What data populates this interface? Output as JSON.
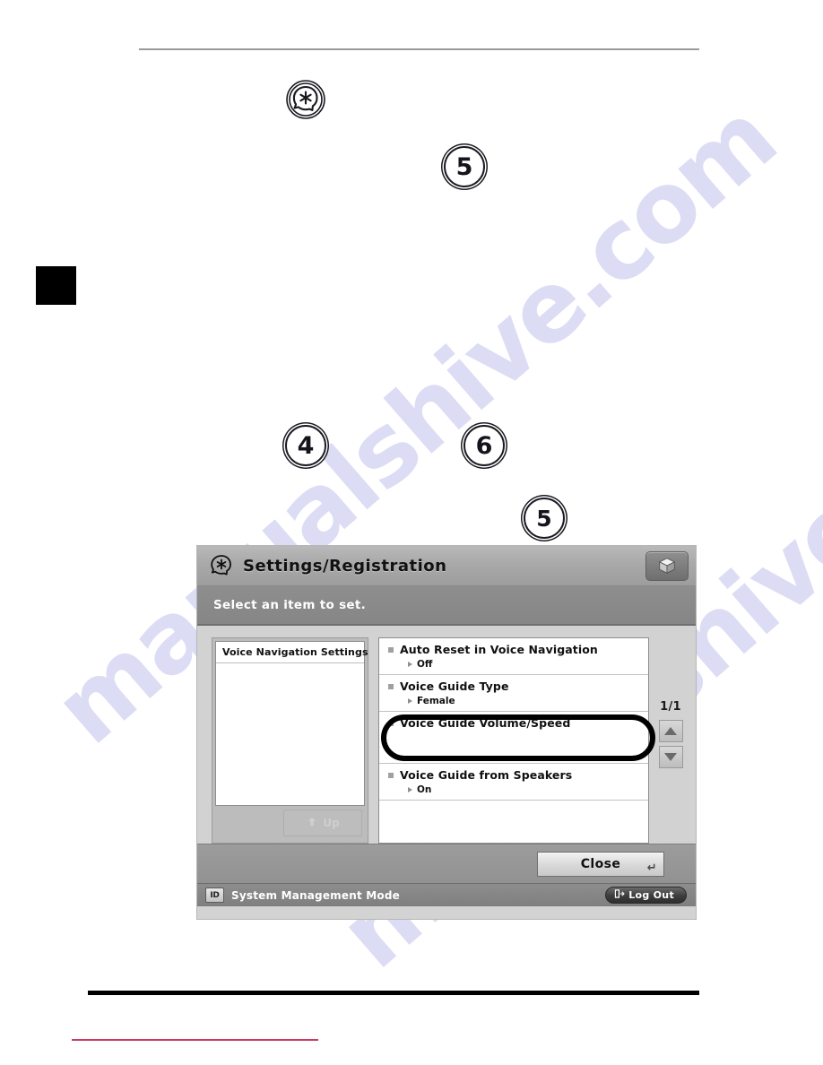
{
  "page": {
    "watermark_text": "manualshive.com",
    "chapter_tab": "",
    "step_markers": {
      "step_four": "4",
      "step_five_top": "5",
      "step_five_bottom": "5",
      "step_six": "6"
    },
    "key_icon_name": "settings-registration-key-icon"
  },
  "screen": {
    "titlebar": {
      "title": "Settings/Registration",
      "key_icon": "settings-registration-icon",
      "cube_button_icon": "cube-icon"
    },
    "message": "Select an item to set.",
    "left_panel": {
      "list_title": "Voice Navigation Settings",
      "up_button_label": "Up",
      "up_button_icon": "arrow-up-return-icon"
    },
    "settings_list": [
      {
        "label": "Auto Reset in Voice Navigation",
        "value": "Off"
      },
      {
        "label": "Voice Guide Type",
        "value": "Female"
      },
      {
        "label": "Voice Guide Volume/Speed",
        "value": ""
      },
      {
        "label": "Voice Guide from Speakers",
        "value": "On"
      }
    ],
    "scroll": {
      "page_indicator": "1/1",
      "up_icon": "triangle-up-icon",
      "down_icon": "triangle-down-icon"
    },
    "actions": {
      "close_label": "Close",
      "enter_glyph": "↵"
    },
    "status": {
      "id_badge": "ID",
      "mode_text": "System Management Mode",
      "logout_label": "Log Out",
      "logout_icon": "exit-door-icon"
    },
    "highlight": {
      "target_label": "Voice Guide Volume/Speed"
    }
  },
  "colors": {
    "callout": "#000000",
    "footer_rule": "#c83a5e",
    "titlebar": "#a9a9a9",
    "body": "#d2d2d2"
  }
}
